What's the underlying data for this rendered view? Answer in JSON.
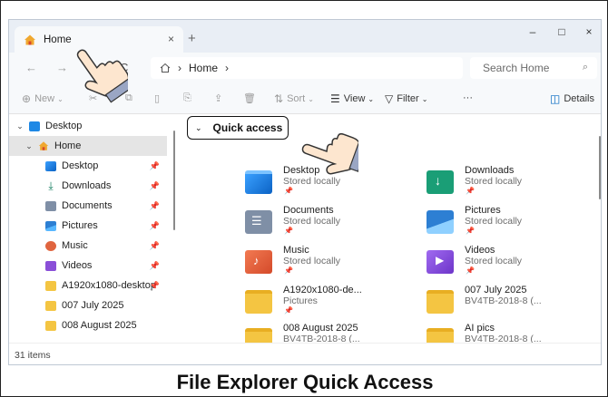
{
  "window": {
    "tab_title": "Home",
    "tab_close": "×",
    "new_tab": "+",
    "minimize": "–",
    "maximize": "□",
    "close": "×"
  },
  "address_bar": {
    "back": "←",
    "forward": "→",
    "up": "↑",
    "refresh": "C",
    "path": [
      "Home"
    ],
    "search_placeholder": "Search Home"
  },
  "commands": {
    "new": "New",
    "sort": "Sort",
    "view": "View",
    "filter": "Filter",
    "more": "···",
    "details": "Details"
  },
  "sidebar": {
    "items": [
      {
        "label": "Desktop",
        "icon": "desktop-icon",
        "chevron": "›"
      },
      {
        "label": "Home",
        "icon": "home-icon",
        "chevron": "⌄"
      },
      {
        "label": "Desktop",
        "icon": "desktop-icon"
      },
      {
        "label": "Downloads",
        "icon": "download-icon"
      },
      {
        "label": "Documents",
        "icon": "documents-icon"
      },
      {
        "label": "Pictures",
        "icon": "pictures-icon"
      },
      {
        "label": "Music",
        "icon": "music-icon"
      },
      {
        "label": "Videos",
        "icon": "videos-icon"
      },
      {
        "label": "A1920x1080-desktop",
        "icon": "folder-icon"
      },
      {
        "label": "007 July 2025",
        "icon": "folder-icon"
      },
      {
        "label": "008 August 2025",
        "icon": "folder-icon"
      }
    ]
  },
  "quick_access": {
    "header": "Quick access",
    "items": [
      {
        "name": "Desktop",
        "sub": "Stored locally",
        "icon": "desktop-folder-icon"
      },
      {
        "name": "Downloads",
        "sub": "Stored locally",
        "icon": "downloads-folder-icon"
      },
      {
        "name": "Documents",
        "sub": "Stored locally",
        "icon": "documents-folder-icon"
      },
      {
        "name": "Pictures",
        "sub": "Stored locally",
        "icon": "pictures-folder-icon"
      },
      {
        "name": "Music",
        "sub": "Stored locally",
        "icon": "music-folder-icon"
      },
      {
        "name": "Videos",
        "sub": "Stored locally",
        "icon": "videos-folder-icon"
      },
      {
        "name": "A1920x1080-de...",
        "sub": "Pictures",
        "icon": "folder-icon"
      },
      {
        "name": "007 July 2025",
        "sub": "BV4TB-2018-8 (...",
        "icon": "folder-icon"
      },
      {
        "name": "008 August 2025",
        "sub": "BV4TB-2018-8 (...",
        "icon": "folder-icon"
      },
      {
        "name": "AI pics",
        "sub": "BV4TB-2018-8 (...",
        "icon": "folder-icon"
      }
    ]
  },
  "status": {
    "items_count": "31 items"
  },
  "caption": "File Explorer Quick Access",
  "colors": {
    "accent": "#0067c0",
    "folder": "#f4c542",
    "titlebar": "#e9eef5",
    "selected": "#e5e5e5"
  }
}
